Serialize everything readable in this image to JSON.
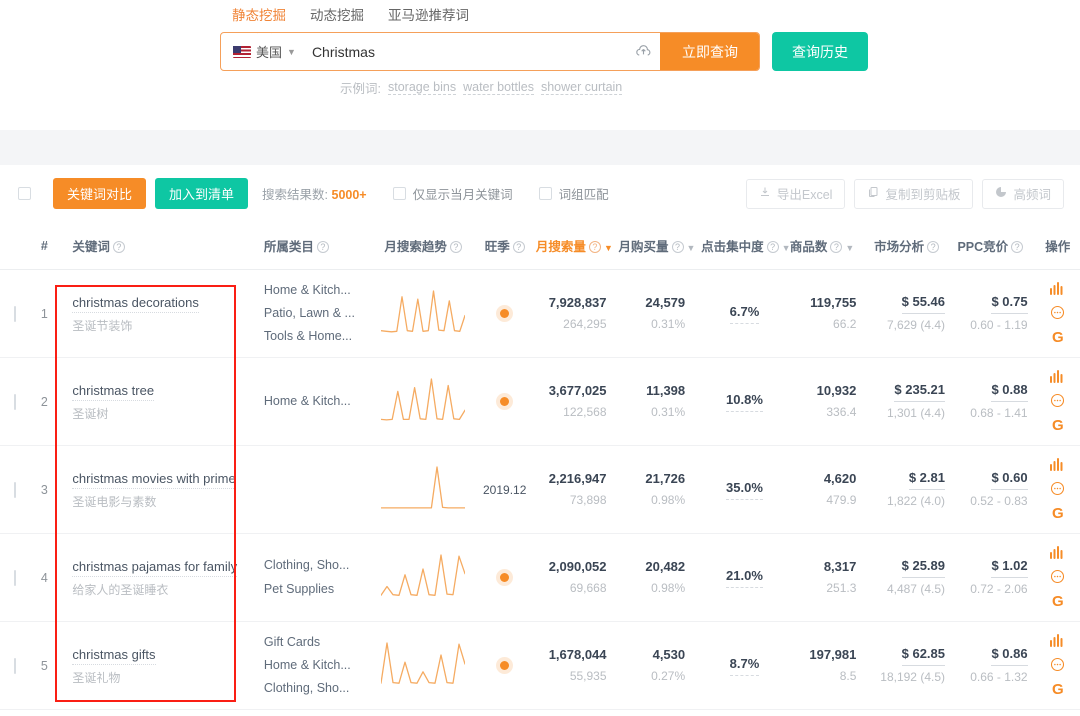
{
  "search": {
    "tabs": [
      {
        "label": "静态挖掘",
        "active": true
      },
      {
        "label": "动态挖掘",
        "active": false
      },
      {
        "label": "亚马逊推荐词",
        "active": false
      }
    ],
    "country": "美国",
    "country_flag": "us-flag-icon",
    "keyword_value": "Christmas",
    "keyword_placeholder": "请输入关键词",
    "upload_icon": "upload-cloud-icon",
    "search_button": "立即查询",
    "history_button": "查询历史",
    "examples_label": "示例词:",
    "examples": [
      "storage bins",
      "water bottles",
      "shower curtain"
    ]
  },
  "toolbar": {
    "select_all_checkbox": "select-all",
    "compare_button": "关键词对比",
    "add_to_list_button": "加入到清单",
    "result_count_label": "搜索结果数:",
    "result_count_value": "5000+",
    "filters": [
      {
        "label": "仅显示当月关键词",
        "checked": false
      },
      {
        "label": "词组匹配",
        "checked": false
      }
    ],
    "right_actions": [
      {
        "label": "导出Excel",
        "icon": "download-icon"
      },
      {
        "label": "复制到剪贴板",
        "icon": "copy-icon"
      },
      {
        "label": "高频词",
        "icon": "pie-chart-icon"
      }
    ]
  },
  "table": {
    "columns": [
      {
        "key": "index",
        "label": "#",
        "help": false,
        "sortable": false,
        "sorted": false
      },
      {
        "key": "keyword",
        "label": "关键词",
        "help": true,
        "sortable": false,
        "sorted": false
      },
      {
        "key": "category",
        "label": "所属类目",
        "help": true,
        "sortable": false,
        "sorted": false
      },
      {
        "key": "trend",
        "label": "月搜索趋势",
        "help": true,
        "sortable": false,
        "sorted": false
      },
      {
        "key": "peak",
        "label": "旺季",
        "help": true,
        "sortable": false,
        "sorted": false
      },
      {
        "key": "searches",
        "label": "月搜索量",
        "help": true,
        "sortable": true,
        "sorted": true
      },
      {
        "key": "purchases",
        "label": "月购买量",
        "help": true,
        "sortable": true,
        "sorted": false
      },
      {
        "key": "click_conc",
        "label": "点击集中度",
        "help": true,
        "sortable": true,
        "sorted": false
      },
      {
        "key": "products",
        "label": "商品数",
        "help": true,
        "sortable": true,
        "sorted": false
      },
      {
        "key": "market",
        "label": "市场分析",
        "help": true,
        "sortable": false,
        "sorted": false
      },
      {
        "key": "ppc",
        "label": "PPC竞价",
        "help": true,
        "sortable": false,
        "sorted": false
      },
      {
        "key": "ops",
        "label": "操作",
        "help": false,
        "sortable": false,
        "sorted": false
      }
    ],
    "rows": [
      {
        "index": "1",
        "keyword_en": "christmas decorations",
        "keyword_cn": "圣诞节装饰",
        "categories": [
          "Home & Kitch...",
          "Patio, Lawn & ...",
          "Tools & Home..."
        ],
        "trend": [
          4,
          3,
          2,
          3,
          62,
          4,
          3,
          58,
          3,
          4,
          72,
          5,
          4,
          55,
          4,
          3,
          30
        ],
        "peak_type": "dot",
        "peak_text": "",
        "searches": "7,928,837",
        "searches_sub": "264,295",
        "purchases": "24,579",
        "purchases_sub": "0.31%",
        "click_conc": "6.7%",
        "products": "119,755",
        "products_sub": "66.2",
        "market": "$ 55.46",
        "market_sub": "7,629 (4.4)",
        "ppc": "$ 0.75",
        "ppc_sub": "0.60 - 1.19"
      },
      {
        "index": "2",
        "keyword_en": "christmas tree",
        "keyword_cn": "圣诞树",
        "categories": [
          "Home & Kitch..."
        ],
        "trend": [
          3,
          2,
          3,
          55,
          3,
          3,
          62,
          4,
          3,
          78,
          4,
          3,
          66,
          4,
          3,
          20
        ],
        "peak_type": "dot",
        "peak_text": "",
        "searches": "3,677,025",
        "searches_sub": "122,568",
        "purchases": "11,398",
        "purchases_sub": "0.31%",
        "click_conc": "10.8%",
        "products": "10,932",
        "products_sub": "336.4",
        "market": "$ 235.21",
        "market_sub": "1,301 (4.4)",
        "ppc": "$ 0.88",
        "ppc_sub": "0.68 - 1.41"
      },
      {
        "index": "3",
        "keyword_en": "christmas movies with prime",
        "keyword_cn": "圣诞电影与素数",
        "categories": [],
        "trend": [
          2,
          2,
          2,
          2,
          2,
          2,
          2,
          2,
          2,
          2,
          78,
          3,
          2,
          2,
          2,
          2
        ],
        "peak_type": "text",
        "peak_text": "2019.12",
        "searches": "2,216,947",
        "searches_sub": "73,898",
        "purchases": "21,726",
        "purchases_sub": "0.98%",
        "click_conc": "35.0%",
        "products": "4,620",
        "products_sub": "479.9",
        "market": "$ 2.81",
        "market_sub": "1,822 (4.0)",
        "ppc": "$ 0.60",
        "ppc_sub": "0.52 - 0.83"
      },
      {
        "index": "4",
        "keyword_en": "christmas pajamas for family",
        "keyword_cn": "给家人的圣诞睡衣",
        "categories": [
          "Clothing, Sho...",
          "Pet Supplies"
        ],
        "trend": [
          3,
          18,
          4,
          3,
          38,
          4,
          3,
          48,
          4,
          3,
          72,
          5,
          4,
          70,
          40
        ],
        "peak_type": "dot",
        "peak_text": "",
        "searches": "2,090,052",
        "searches_sub": "69,668",
        "purchases": "20,482",
        "purchases_sub": "0.98%",
        "click_conc": "21.0%",
        "products": "8,317",
        "products_sub": "251.3",
        "market": "$ 25.89",
        "market_sub": "4,487 (4.5)",
        "ppc": "$ 1.02",
        "ppc_sub": "0.72 - 2.06"
      },
      {
        "index": "5",
        "keyword_en": "christmas gifts",
        "keyword_cn": "圣诞礼物",
        "categories": [
          "Gift Cards",
          "Home & Kitch...",
          "Clothing, Sho..."
        ],
        "trend": [
          3,
          70,
          4,
          3,
          38,
          4,
          3,
          22,
          4,
          3,
          50,
          4,
          3,
          68,
          35
        ],
        "peak_type": "dot",
        "peak_text": "",
        "searches": "1,678,044",
        "searches_sub": "55,935",
        "purchases": "4,530",
        "purchases_sub": "0.27%",
        "click_conc": "8.7%",
        "products": "197,981",
        "products_sub": "8.5",
        "market": "$ 62.85",
        "market_sub": "18,192 (4.5)",
        "ppc": "$ 0.86",
        "ppc_sub": "0.66 - 1.32"
      }
    ],
    "row_ops_icons": [
      "bar-chart-icon",
      "more-circle-icon",
      "google-icon"
    ]
  },
  "colors": {
    "accent_orange": "#f68c27",
    "accent_teal": "#0ec7a3",
    "annotation_red": "#fa1e14",
    "text_dark": "#3a4554",
    "text_muted": "#b9bdc2"
  }
}
